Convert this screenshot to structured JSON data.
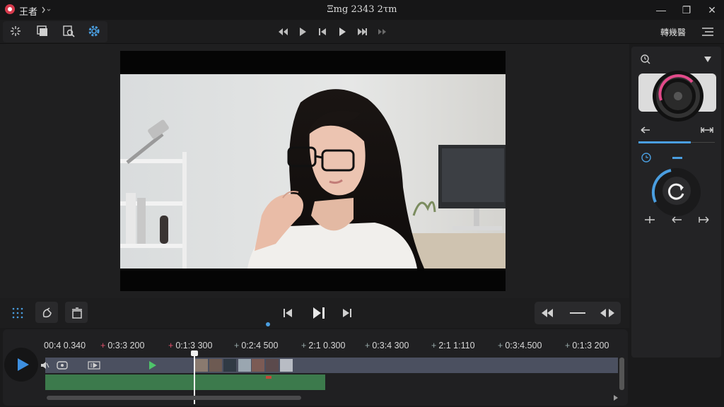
{
  "app": {
    "name": "王者",
    "window_title": "Ξmg 2343 2τm"
  },
  "window_controls": {
    "minimize": "—",
    "maximize": "❐",
    "close": "✕"
  },
  "toolbar": {
    "tools": [
      "sparkle-icon",
      "layers-icon",
      "search-doc-icon",
      "settings-icon"
    ],
    "transport": [
      "rewind-icon",
      "play-icon",
      "step-back-icon",
      "play-icon",
      "fast-forward-icon",
      "skip-icon"
    ],
    "preset_label": "轉幾醫",
    "accent": "#4a9ee0"
  },
  "timeline": {
    "ticks": [
      {
        "label": "00:4 0.340",
        "marker": ""
      },
      {
        "label": "0:3:3 200",
        "marker": "+",
        "marker_color": "red"
      },
      {
        "label": "0:1:3 300",
        "marker": "+",
        "marker_color": "red"
      },
      {
        "label": "0:2:4 500",
        "marker": "+"
      },
      {
        "label": "2:1 0.300",
        "marker": "+"
      },
      {
        "label": "0:3:4 300",
        "marker": "+"
      },
      {
        "label": "2:1 1:110",
        "marker": "+"
      },
      {
        "label": "0:3:4.500",
        "marker": "+"
      },
      {
        "label": "0:1:3 200",
        "marker": "+"
      }
    ],
    "audio_color": "#3c7a4c",
    "video_color": "#4b5060"
  }
}
